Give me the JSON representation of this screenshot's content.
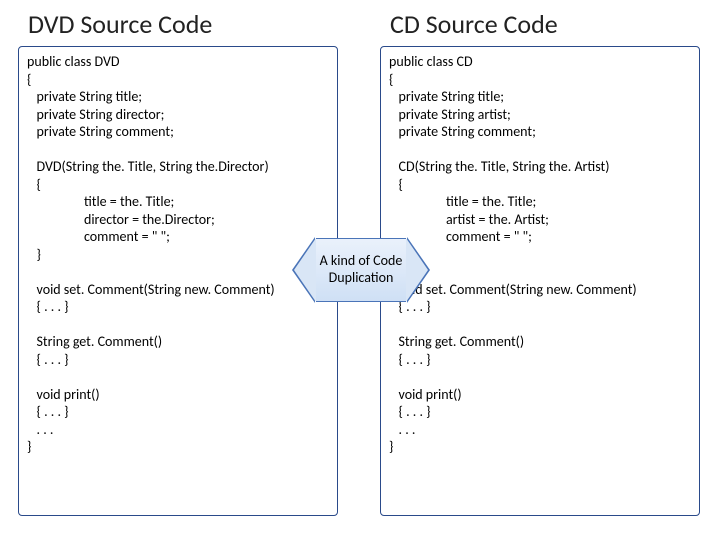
{
  "left": {
    "title": "DVD Source Code",
    "code": "public class DVD\n{\n   private String title;\n   private String director;\n   private String comment;\n\n   DVD(String the. Title, String the.Director)\n   {\n                  title = the. Title;\n                  director = the.Director;\n                  comment = \" \";\n   }\n\n   void set. Comment(String new. Comment)\n   { . . . }\n\n   String get. Comment()\n   { . . . }\n\n   void print()\n   { . . . }\n   . . .\n}"
  },
  "right": {
    "title": "CD Source Code",
    "code": "public class CD\n{\n   private String title;\n   private String artist;\n   private String comment;\n\n   CD(String the. Title, String the. Artist)\n   {\n                  title = the. Title;\n                  artist = the. Artist;\n                  comment = \" \";\n   }\n\n   void set. Comment(String new. Comment)\n   { . . . }\n\n   String get. Comment()\n   { . . . }\n\n   void print()\n   { . . . }\n   . . .\n}"
  },
  "callout": {
    "text": "A kind of\nCode\nDuplication"
  }
}
